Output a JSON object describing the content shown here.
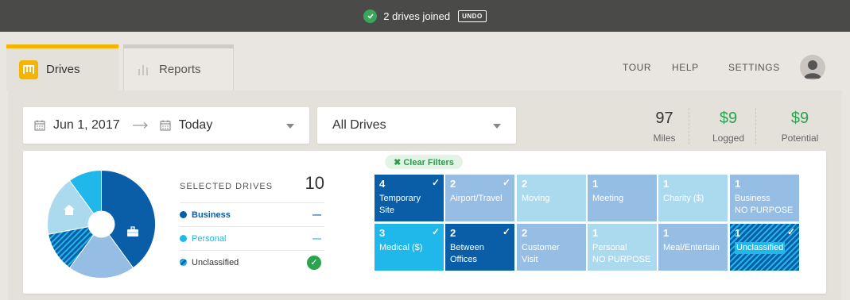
{
  "toast": {
    "message": "2 drives joined",
    "undo": "UNDO"
  },
  "tabs": [
    {
      "label": "Drives",
      "icon": "mileiq-logo-icon"
    },
    {
      "label": "Reports",
      "icon": "bar-chart-icon"
    }
  ],
  "nav": {
    "tour": "TOUR",
    "help": "HELP",
    "settings": "SETTINGS"
  },
  "filters": {
    "start_date": "Jun 1, 2017",
    "end_date": "Today",
    "drive_type": "All Drives"
  },
  "stats": [
    {
      "value": "97",
      "label": "Miles"
    },
    {
      "value": "$9",
      "label": "Logged"
    },
    {
      "value": "$9",
      "label": "Potential"
    }
  ],
  "selected": {
    "title": "SELECTED DRIVES",
    "count": "10"
  },
  "legend": [
    {
      "label": "Business",
      "color": "#0a5ea8",
      "mark": "—"
    },
    {
      "label": "Personal",
      "color": "#20b7ea",
      "mark": "—"
    },
    {
      "label": "Unclassified",
      "color": "#1e6fb5",
      "mark": "✓"
    }
  ],
  "pie": {
    "business": 4,
    "personal": 3,
    "unclassified": 3
  },
  "clear_filters": "✖ Clear Filters",
  "tiles": [
    {
      "count": "4",
      "line1": "Temporary",
      "line2": "Site",
      "style": "dark",
      "checked": true
    },
    {
      "count": "2",
      "line1": "Airport/Travel",
      "line2": "",
      "style": "mid",
      "checked": true
    },
    {
      "count": "2",
      "line1": "Moving",
      "line2": "",
      "style": "light",
      "checked": false
    },
    {
      "count": "1",
      "line1": "Meeting",
      "line2": "",
      "style": "mid",
      "checked": false
    },
    {
      "count": "1",
      "line1": "Charity ($)",
      "line2": "",
      "style": "light",
      "checked": false
    },
    {
      "count": "1",
      "line1": "Business",
      "line2": "NO PURPOSE",
      "style": "mid",
      "checked": false
    },
    {
      "count": "3",
      "line1": "Medical ($)",
      "line2": "",
      "style": "bright",
      "checked": true
    },
    {
      "count": "2",
      "line1": "Between",
      "line2": "Offices",
      "style": "dark",
      "checked": true
    },
    {
      "count": "2",
      "line1": "Customer",
      "line2": "Visit",
      "style": "mid",
      "checked": false
    },
    {
      "count": "1",
      "line1": "Personal",
      "line2": "NO PURPOSE",
      "style": "light",
      "checked": false
    },
    {
      "count": "1",
      "line1": "Meal/Entertain",
      "line2": "",
      "style": "mid",
      "checked": false
    },
    {
      "count": "1",
      "line1": "Unclassified",
      "line2": "",
      "style": "hatch",
      "checked": true
    }
  ]
}
